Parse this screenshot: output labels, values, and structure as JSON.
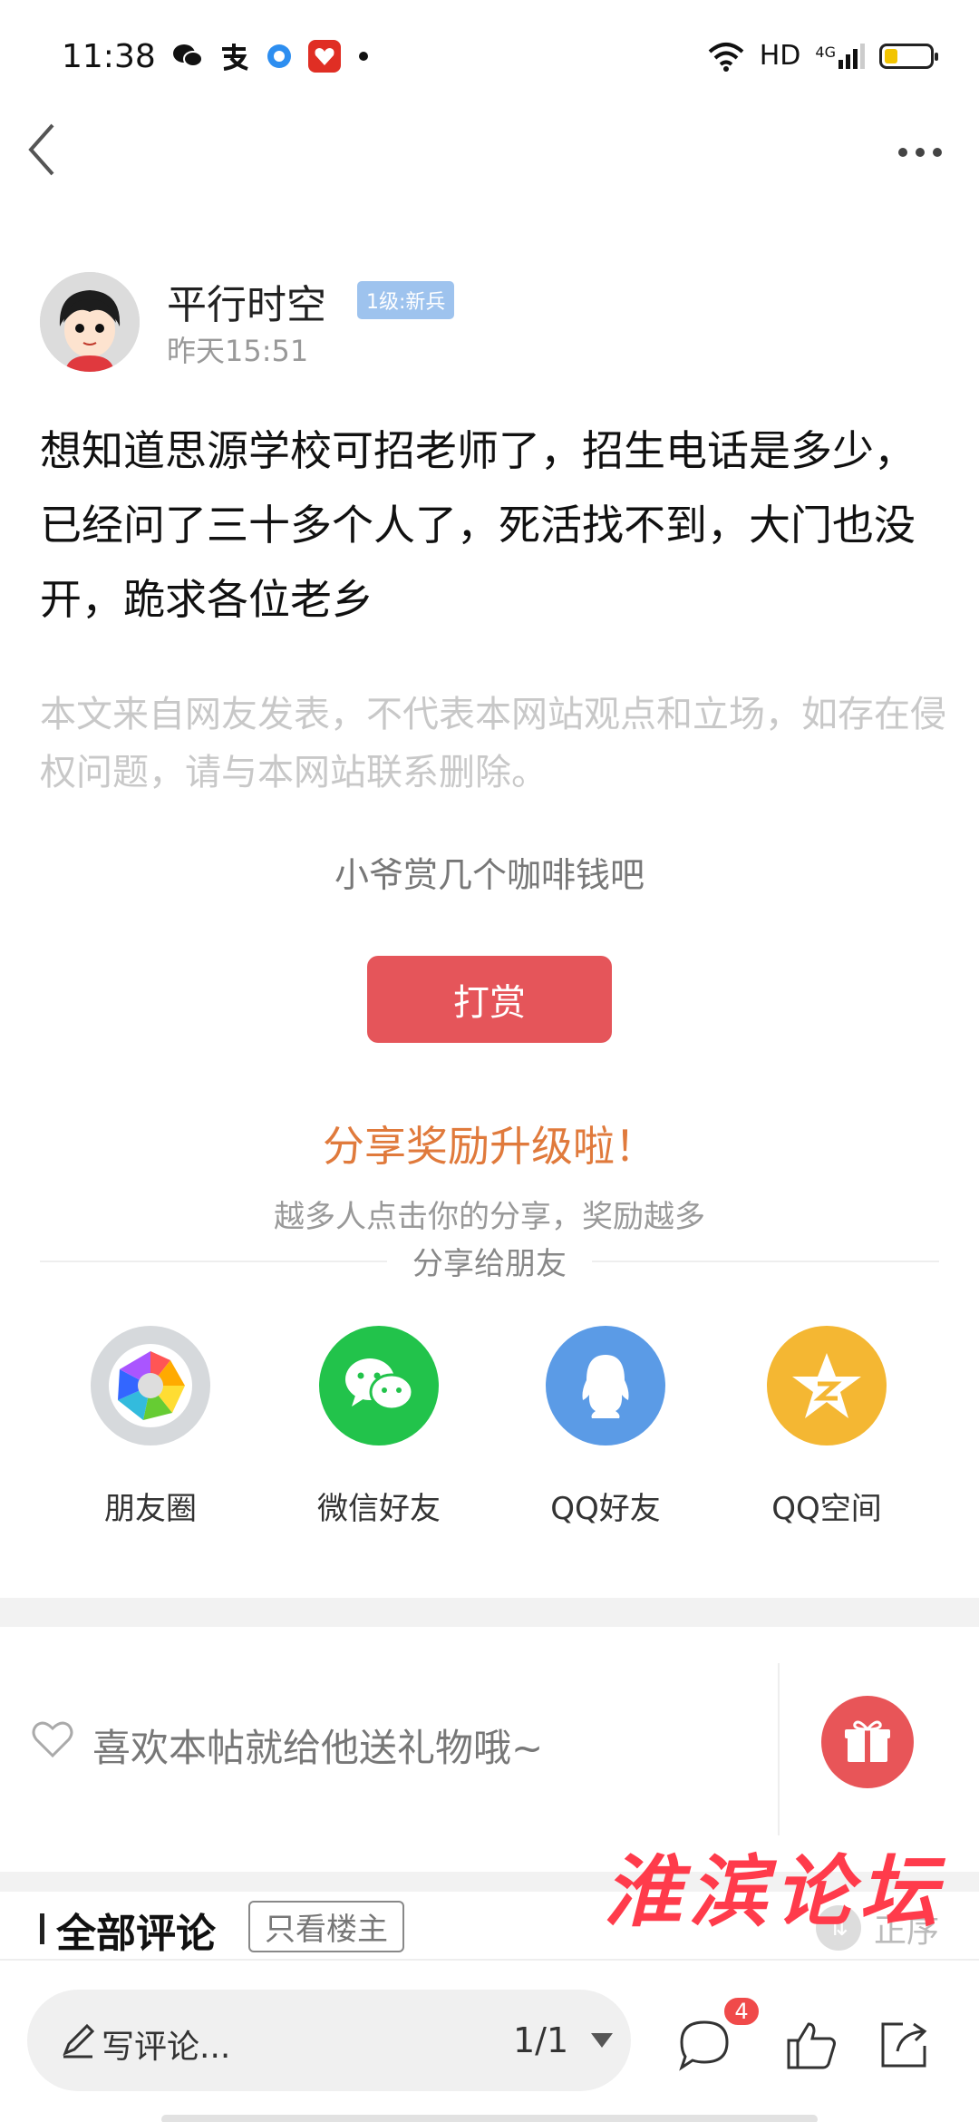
{
  "status_bar": {
    "time": "11:38",
    "network": "HD",
    "signal": "4G",
    "battery_level": 0.3,
    "app_icons": [
      "wechat-icon",
      "alipay-icon",
      "browser-icon",
      "pinduoduo-icon"
    ]
  },
  "nav": {
    "back_icon": "chevron-left-icon",
    "more_icon": "more-dots-icon"
  },
  "author": {
    "name": "平行时空",
    "level": "1级:新兵",
    "time": "昨天15:51"
  },
  "post": {
    "content": "想知道思源学校可招老师了，招生电话是多少，已经问了三十多个人了，死活找不到，大门也没开，跪求各位老乡",
    "disclaimer": "本文来自网友发表，不代表本网站观点和立场，如存在侵权问题，请与本网站联系删除。"
  },
  "reward": {
    "tip": "小爷赏几个咖啡钱吧",
    "button": "打赏"
  },
  "share": {
    "title": "分享奖励升级啦！",
    "subtitle": "越多人点击你的分享，奖励越多",
    "label": "分享给朋友",
    "targets": [
      {
        "name": "朋友圈",
        "icon": "moments-icon",
        "color": "#d6d9dc"
      },
      {
        "name": "微信好友",
        "icon": "wechat-icon",
        "color": "#22c34b"
      },
      {
        "name": "QQ好友",
        "icon": "qq-icon",
        "color": "#5b9be6"
      },
      {
        "name": "QQ空间",
        "icon": "qzone-icon",
        "color": "#f4b733"
      }
    ]
  },
  "gift": {
    "text": "喜欢本帖就给他送礼物哦~",
    "icon": "gift-icon"
  },
  "comments": {
    "title": "全部评论",
    "filter": "只看楼主",
    "sort": "正序"
  },
  "watermark": "淮滨论坛",
  "bottom_bar": {
    "placeholder": "写评论...",
    "page": "1/1",
    "comment_count": "4",
    "icons": [
      "comment-icon",
      "like-icon",
      "share-icon"
    ]
  }
}
